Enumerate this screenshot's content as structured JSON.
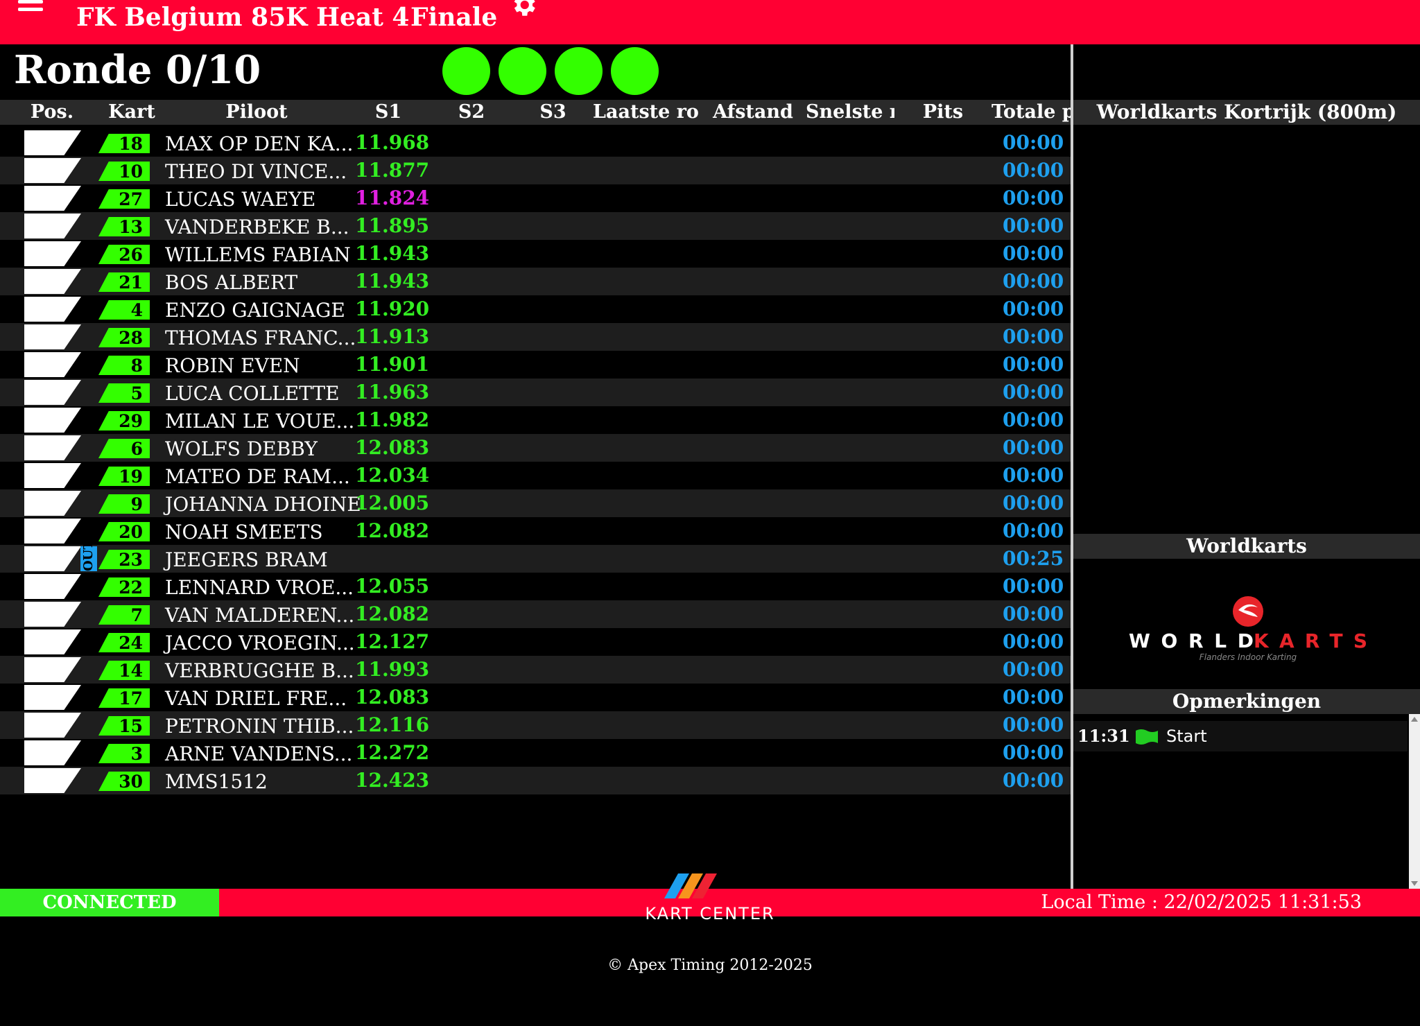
{
  "header": {
    "title": "FK Belgium 85K Heat 4",
    "subtitle": "Finale"
  },
  "lap_counter": "Ronde 0/10",
  "lights": {
    "count": 4,
    "color": "#33ff00"
  },
  "table": {
    "columns": [
      "Pos.",
      "Kart",
      "Piloot",
      "S1",
      "S2",
      "S3",
      "Laatste ro",
      "Afstand",
      "Snelste r",
      "Pits",
      "Totale p"
    ],
    "rows": [
      {
        "kart": "18",
        "pilot": "MAX OP DEN KA...",
        "s1": "11.968",
        "s1_color": "#33ee22",
        "total": "00:00"
      },
      {
        "kart": "10",
        "pilot": "THEO DI VINCE...",
        "s1": "11.877",
        "s1_color": "#33ee22",
        "total": "00:00"
      },
      {
        "kart": "27",
        "pilot": "LUCAS WAEYE",
        "s1": "11.824",
        "s1_color": "#e020e0",
        "total": "00:00"
      },
      {
        "kart": "13",
        "pilot": "VANDERBEKE B...",
        "s1": "11.895",
        "s1_color": "#33ee22",
        "total": "00:00"
      },
      {
        "kart": "26",
        "pilot": "WILLEMS FABIAN",
        "s1": "11.943",
        "s1_color": "#33ee22",
        "total": "00:00"
      },
      {
        "kart": "21",
        "pilot": "BOS ALBERT",
        "s1": "11.943",
        "s1_color": "#33ee22",
        "total": "00:00"
      },
      {
        "kart": "4",
        "pilot": "ENZO GAIGNAGE",
        "s1": "11.920",
        "s1_color": "#33ee22",
        "total": "00:00"
      },
      {
        "kart": "28",
        "pilot": "THOMAS FRANC...",
        "s1": "11.913",
        "s1_color": "#33ee22",
        "total": "00:00"
      },
      {
        "kart": "8",
        "pilot": "ROBIN EVEN",
        "s1": "11.901",
        "s1_color": "#33ee22",
        "total": "00:00"
      },
      {
        "kart": "5",
        "pilot": "LUCA COLLETTE",
        "s1": "11.963",
        "s1_color": "#33ee22",
        "total": "00:00"
      },
      {
        "kart": "29",
        "pilot": "MILAN LE VOUE...",
        "s1": "11.982",
        "s1_color": "#33ee22",
        "total": "00:00"
      },
      {
        "kart": "6",
        "pilot": "WOLFS DEBBY",
        "s1": "12.083",
        "s1_color": "#33ee22",
        "total": "00:00"
      },
      {
        "kart": "19",
        "pilot": "MATEO DE RAM...",
        "s1": "12.034",
        "s1_color": "#33ee22",
        "total": "00:00"
      },
      {
        "kart": "9",
        "pilot": "JOHANNA DHOINE",
        "s1": "12.005",
        "s1_color": "#33ee22",
        "total": "00:00"
      },
      {
        "kart": "20",
        "pilot": "NOAH SMEETS",
        "s1": "12.082",
        "s1_color": "#33ee22",
        "total": "00:00"
      },
      {
        "kart": "23",
        "pilot": "JEEGERS BRAM",
        "s1": "",
        "s1_color": "#33ee22",
        "total": "00:25",
        "badge": "OUT"
      },
      {
        "kart": "22",
        "pilot": "LENNARD VROE...",
        "s1": "12.055",
        "s1_color": "#33ee22",
        "total": "00:00"
      },
      {
        "kart": "7",
        "pilot": "VAN MALDEREN...",
        "s1": "12.082",
        "s1_color": "#33ee22",
        "total": "00:00"
      },
      {
        "kart": "24",
        "pilot": "JACCO VROEGIN...",
        "s1": "12.127",
        "s1_color": "#33ee22",
        "total": "00:00"
      },
      {
        "kart": "14",
        "pilot": "VERBRUGGHE B...",
        "s1": "11.993",
        "s1_color": "#33ee22",
        "total": "00:00"
      },
      {
        "kart": "17",
        "pilot": "VAN DRIEL FRE...",
        "s1": "12.083",
        "s1_color": "#33ee22",
        "total": "00:00"
      },
      {
        "kart": "15",
        "pilot": "PETRONIN THIB...",
        "s1": "12.116",
        "s1_color": "#33ee22",
        "total": "00:00"
      },
      {
        "kart": "3",
        "pilot": "ARNE VANDENS...",
        "s1": "12.272",
        "s1_color": "#33ee22",
        "total": "00:00"
      },
      {
        "kart": "30",
        "pilot": "MMS1512",
        "s1": "12.423",
        "s1_color": "#33ee22",
        "total": "00:00"
      }
    ]
  },
  "right_panel": {
    "track_title": "Worldkarts Kortrijk (800m)",
    "sponsor_title": "Worldkarts",
    "sponsor_logo": {
      "word_white": "WORLD",
      "word_red": "KARTS",
      "tagline": "Flanders Indoor Karting"
    },
    "remarks_title": "Opmerkingen",
    "remarks": [
      {
        "time": "11:31",
        "icon": "green-flag-icon",
        "text": "Start"
      }
    ]
  },
  "footer": {
    "status": "CONNECTED",
    "local_time": "Local Time : 22/02/2025 11:31:53",
    "brand": "KART CENTER",
    "copyright": "© Apex Timing 2012-2025"
  },
  "colors": {
    "brand_red": "#ff0033",
    "green": "#33ff00",
    "blue": "#1ea0ef",
    "fastest": "#e020e0"
  }
}
